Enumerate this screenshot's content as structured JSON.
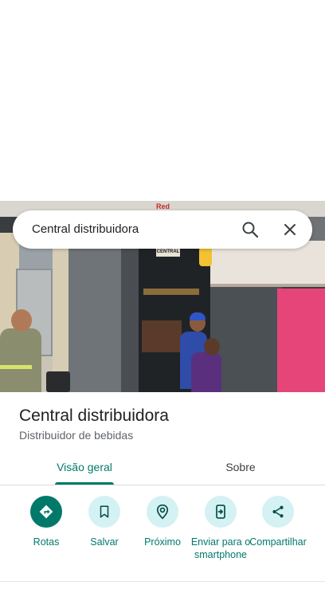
{
  "search": {
    "query": "Central distribuidora"
  },
  "photo": {
    "sign_text": "Red Bull",
    "shop_sign_text": "CENTRAL"
  },
  "place": {
    "title": "Central distribuidora",
    "category": "Distribuidor de bebidas"
  },
  "tabs": [
    {
      "label": "Visão geral",
      "active": true
    },
    {
      "label": "Sobre",
      "active": false
    }
  ],
  "actions": [
    {
      "label": "Rotas",
      "icon": "directions-icon"
    },
    {
      "label": "Salvar",
      "icon": "bookmark-icon"
    },
    {
      "label": "Próximo",
      "icon": "nearby-icon"
    },
    {
      "label": "Enviar para o smartphone",
      "icon": "send-to-phone-icon"
    },
    {
      "label": "Compartilhar",
      "icon": "share-icon"
    }
  ],
  "colors": {
    "accent": "#00796b",
    "action_bg": "#d4f1f4"
  }
}
